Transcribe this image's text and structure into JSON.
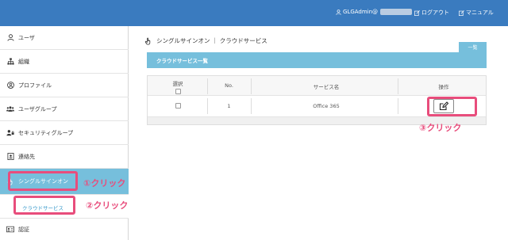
{
  "header": {
    "user": "GLGAdmin@",
    "logout": "ログアウト",
    "manual": "マニュアル"
  },
  "sidebar": {
    "items": [
      {
        "label": "ユーザ"
      },
      {
        "label": "組織"
      },
      {
        "label": "プロファイル"
      },
      {
        "label": "ユーザグループ"
      },
      {
        "label": "セキュリティグループ"
      },
      {
        "label": "連絡先"
      },
      {
        "label": "シングルサインオン"
      },
      {
        "label": "認証"
      }
    ],
    "sub_item": "クラウドサービス"
  },
  "main": {
    "title": "シングルサインオン ｜ クラウドサービス",
    "tab_button": "一覧",
    "panel_title": "クラウドサービス一覧",
    "table": {
      "headers": [
        "選択",
        "No.",
        "サービス名",
        "操作"
      ],
      "rows": [
        {
          "no": "1",
          "service": "Office 365"
        }
      ]
    }
  },
  "annotations": {
    "step1": "①クリック",
    "step2": "②クリック",
    "step3": "③クリック",
    "color": "#e84d7c"
  },
  "colors": {
    "header_bg": "#3a7bbf",
    "accent": "#76bfdc"
  }
}
